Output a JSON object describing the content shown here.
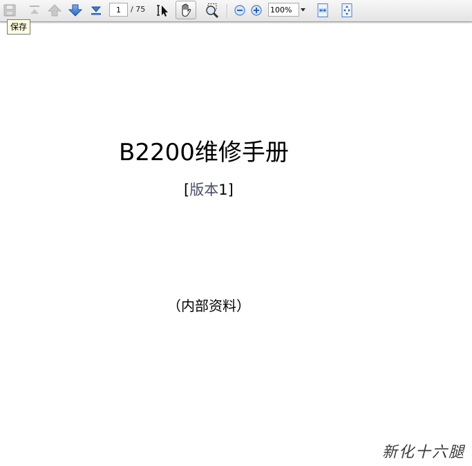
{
  "toolbar": {
    "page_current": "1",
    "page_total": "/ 75",
    "zoom": "100%",
    "save_tooltip": "保存",
    "icons": {
      "save": "save-icon",
      "first_page": "first-page-icon",
      "previous_page": "previous-page-icon",
      "next_page": "next-page-icon",
      "last_page": "last-page-icon",
      "select_text": "text-select-icon",
      "hand": "hand-tool-icon",
      "marquee_zoom": "marquee-zoom-icon",
      "zoom_out": "zoom-out-icon",
      "zoom_in": "zoom-in-icon",
      "zoom_dropdown": "chevron-down-icon",
      "fit_width": "fit-width-icon",
      "fit_page": "fit-page-icon"
    }
  },
  "document": {
    "title": "B2200维修手册",
    "version_open": "[",
    "version_text": "版本",
    "version_number": "1]",
    "internal_note": "（内部资料）",
    "watermark": "新化十六腿"
  },
  "colors": {
    "toolbar_bg": "#e9e9e9",
    "page_bg": "#ffffff",
    "nav_arrow_blue": "#3a7bd5",
    "tooltip_bg": "#ffffe1"
  }
}
